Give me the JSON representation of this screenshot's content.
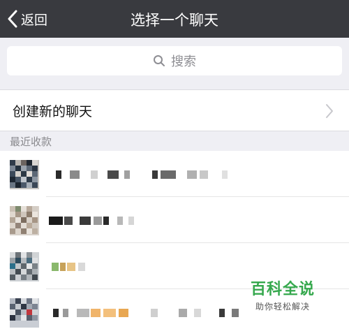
{
  "navbar": {
    "back_label": "返回",
    "title": "选择一个聊天",
    "background": "#393a3f"
  },
  "search": {
    "placeholder": "搜索",
    "icon": "search-icon"
  },
  "new_chat": {
    "label": "创建新的聊天",
    "icon": "chevron-right-icon"
  },
  "section": {
    "label": "最近收款"
  },
  "contacts": [
    {
      "avatar": "pixelated",
      "name": "pixelated"
    },
    {
      "avatar": "pixelated",
      "name": "pixelated"
    },
    {
      "avatar": "pixelated",
      "name": "pixelated"
    },
    {
      "avatar": "pixelated",
      "name": "pixelated"
    }
  ],
  "watermark": {
    "brand": "百科全说",
    "subtitle": "助你轻松解决",
    "color": "#35a84d"
  }
}
